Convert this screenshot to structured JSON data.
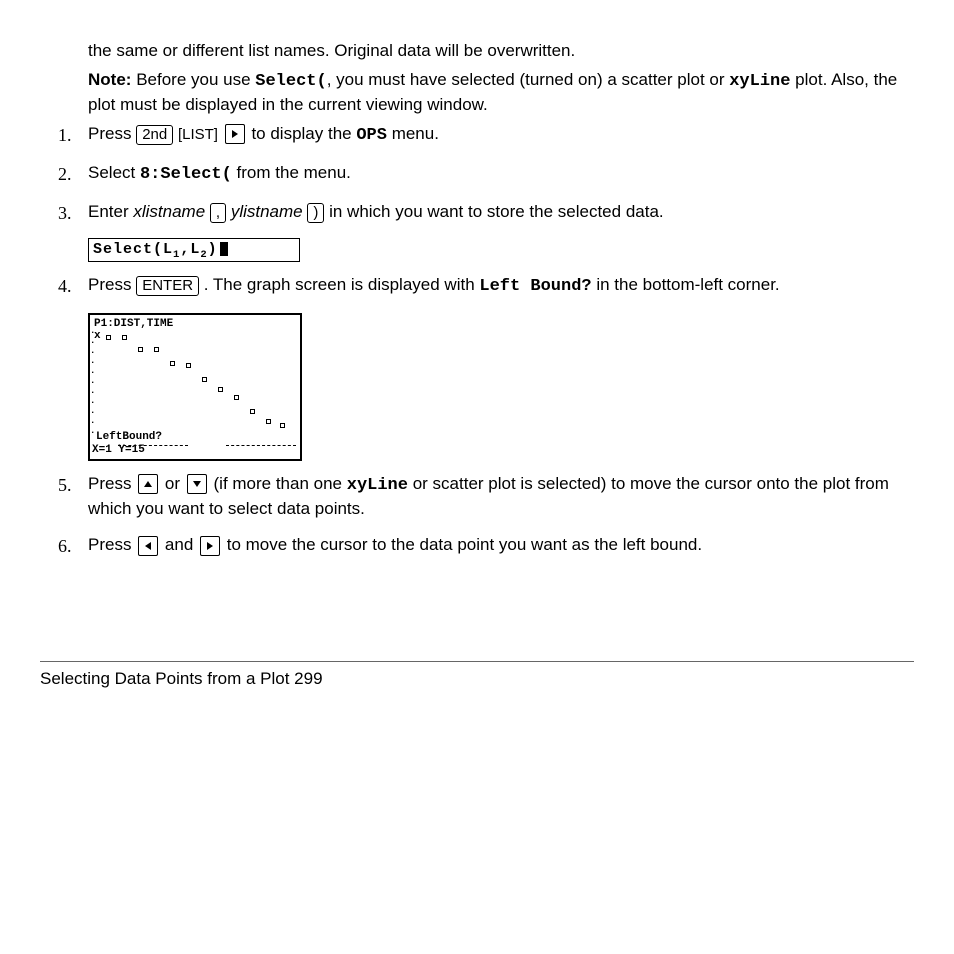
{
  "step1": {
    "num": "1.",
    "before_key": "Press ",
    "key2nd": "2nd",
    "keyList": "[LIST]",
    "after_arrow": " to display the ",
    "ops": "OPS",
    "after_ops": " menu."
  },
  "step2": {
    "num": "2.",
    "a": "Select ",
    "mono": "8:Select(",
    "b": " from the menu."
  },
  "step3": {
    "num": "3.",
    "a": "Enter ",
    "xlist": "xlistname",
    "comma_key": ",",
    "ylist": "ylistname",
    "close_key": ")",
    "b": " in which you want to store the selected data."
  },
  "lcd1_text": "Select(L₁,L₂)",
  "step4": {
    "num": "4.",
    "a": "Press ",
    "enter": "ENTER",
    "b": ". The graph screen is displayed with ",
    "c": "Left Bound?",
    "d": " in the bottom-left corner."
  },
  "chart_data": {
    "type": "scatter",
    "title": "P1:DIST,TIME",
    "prompt": "LeftBound?",
    "status": "X=1             Y=15",
    "x": [
      1,
      2,
      3,
      4,
      5,
      6,
      7,
      8,
      9,
      10,
      11,
      12
    ],
    "y": [
      15,
      15,
      11,
      11,
      10.5,
      10.5,
      9,
      7.5,
      7,
      5,
      3.5,
      2.5
    ]
  },
  "step5": {
    "num": "5.",
    "a": "Press ",
    "b": " or ",
    "c": " (if more than one ",
    "d": "xyLine",
    "e": " or scatter plot is selected) to move the cursor onto the plot from which you want to select data points."
  },
  "step6": {
    "num": "6.",
    "c_before": "Press ",
    "c_after": " and "
  }
}
